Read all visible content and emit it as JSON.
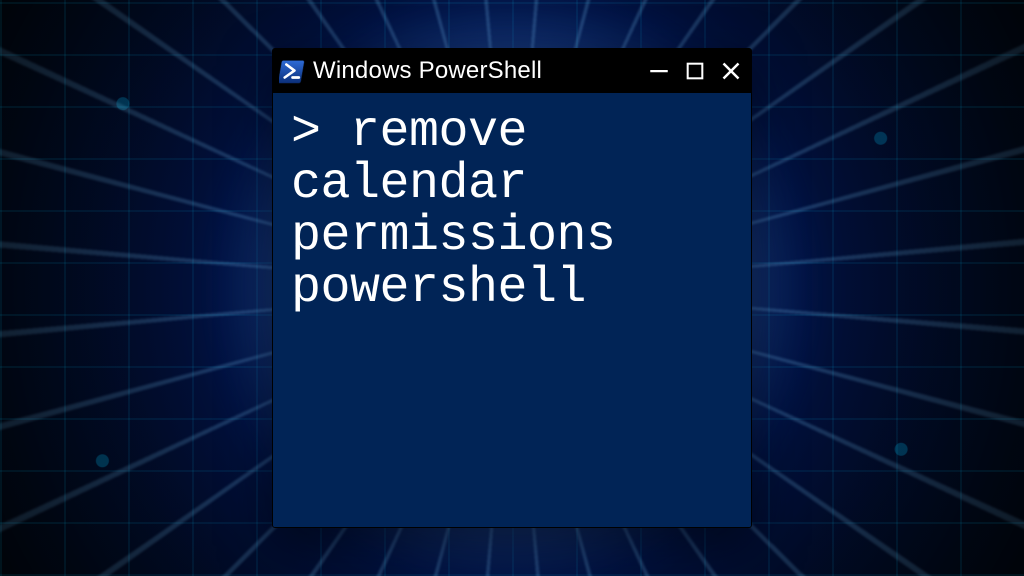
{
  "window": {
    "title": "Windows PowerShell",
    "icons": {
      "app": "powershell-icon",
      "minimize": "minimize-icon",
      "maximize": "maximize-icon",
      "close": "close-icon"
    },
    "colors": {
      "titlebar_bg": "#000000",
      "titlebar_fg": "#ffffff",
      "console_bg": "#012456",
      "console_fg": "#ffffff"
    }
  },
  "console": {
    "prompt": ">",
    "command": "remove calendar permissions powershell"
  }
}
